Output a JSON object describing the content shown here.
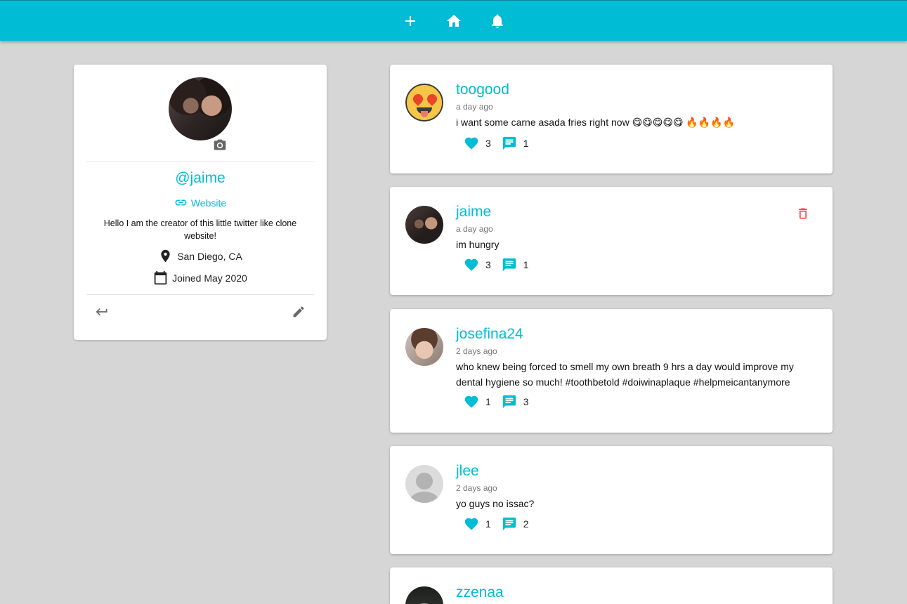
{
  "nav": {
    "items": [
      {
        "name": "add-post-button",
        "icon": "plus-icon"
      },
      {
        "name": "home-button",
        "icon": "home-icon"
      },
      {
        "name": "notifications-button",
        "icon": "bell-icon"
      }
    ],
    "color": "#00bcd4"
  },
  "profile": {
    "handle": "@jaime",
    "website_label": "Website",
    "bio": "Hello I am the creator of this little twitter like clone website!",
    "location": "San Diego, CA",
    "joined": "Joined May 2020",
    "icons": [
      "camera-icon",
      "link-icon",
      "location-pin-icon",
      "calendar-icon",
      "logout-icon",
      "edit-icon"
    ]
  },
  "posts": [
    {
      "user": "toogood",
      "time": "a day ago",
      "body": "i want some carne asada fries right now 😋😋😋😋😋 🔥🔥🔥🔥",
      "likes": "3",
      "comments": "1",
      "deletable": false
    },
    {
      "user": "jaime",
      "time": "a day ago",
      "body": "im hungry",
      "likes": "3",
      "comments": "1",
      "deletable": true
    },
    {
      "user": "josefina24",
      "time": "2 days ago",
      "body": "who knew being forced to smell my own breath 9 hrs a day would improve my dental hygiene so much! #toothbetold #doiwinaplaque #helpmeicantanymore",
      "likes": "1",
      "comments": "3",
      "deletable": false
    },
    {
      "user": "jlee",
      "time": "2 days ago",
      "body": "yo guys no issac?",
      "likes": "1",
      "comments": "2",
      "deletable": false
    },
    {
      "user": "zzenaa",
      "time": "",
      "body": "",
      "likes": "",
      "comments": "",
      "deletable": false
    }
  ],
  "colors": {
    "accent": "#00bcd4",
    "danger": "#f44336",
    "background": "#d6d6d6"
  }
}
